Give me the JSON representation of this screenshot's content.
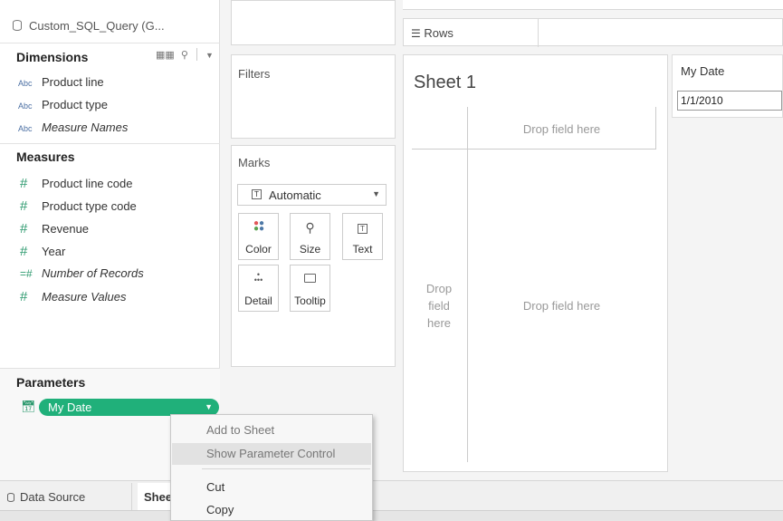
{
  "datasource": {
    "name": "Custom_SQL_Query (G..."
  },
  "dimensions": {
    "title": "Dimensions",
    "items": [
      {
        "type": "Abc",
        "label": "Product line"
      },
      {
        "type": "Abc",
        "label": "Product type"
      },
      {
        "type": "Abc",
        "label": "Measure Names"
      }
    ]
  },
  "measures": {
    "title": "Measures",
    "items": [
      {
        "type": "#",
        "label": "Product line code"
      },
      {
        "type": "#",
        "label": "Product type code"
      },
      {
        "type": "#",
        "label": "Revenue"
      },
      {
        "type": "#",
        "label": "Year"
      },
      {
        "type": "=#",
        "label": "Number of Records"
      },
      {
        "type": "#",
        "label": "Measure Values"
      }
    ]
  },
  "parameters": {
    "title": "Parameters",
    "pill_label": "My Date"
  },
  "shelves": {
    "rows_label": "Rows",
    "filters_label": "Filters",
    "marks_label": "Marks"
  },
  "marks": {
    "type": "Automatic",
    "buttons": [
      {
        "label": "Color"
      },
      {
        "label": "Size"
      },
      {
        "label": "Text"
      },
      {
        "label": "Detail"
      },
      {
        "label": "Tooltip"
      }
    ]
  },
  "view": {
    "title": "Sheet 1",
    "drop_top": "Drop field here",
    "drop_left": "Drop\nfield\nhere",
    "drop_main": "Drop field here"
  },
  "param_control": {
    "title": "My Date",
    "value": "1/1/2010"
  },
  "tabs": {
    "data_source": "Data Source",
    "sheet": "Sheet 1"
  },
  "context_menu": {
    "items": [
      {
        "label": "Add to Sheet"
      },
      {
        "label": "Show Parameter Control"
      },
      {
        "label": "Cut"
      },
      {
        "label": "Copy"
      }
    ]
  },
  "colors": {
    "accent": "#20b07a",
    "menu_bg": "#f7f7f7"
  }
}
